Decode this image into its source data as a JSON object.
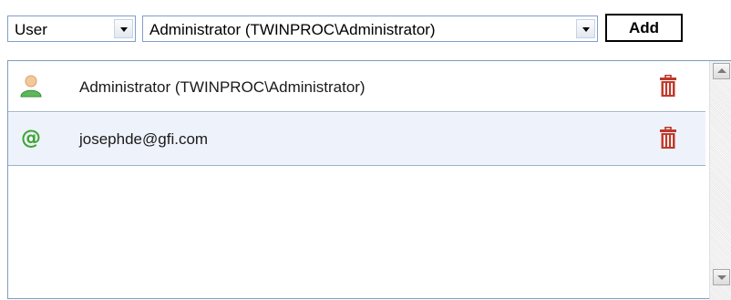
{
  "toolbar": {
    "type_select": {
      "value": "User",
      "icon": "chevron-down-icon"
    },
    "account_select": {
      "value": "Administrator (TWINPROC\\Administrator)",
      "icon": "chevron-down-icon"
    },
    "add_label": "Add"
  },
  "list": {
    "items": [
      {
        "label": "Administrator (TWINPROC\\Administrator)",
        "icon": "user-icon",
        "selected": false
      },
      {
        "label": "josephde@gfi.com",
        "icon": "email-at-icon",
        "selected": true
      }
    ],
    "delete_icon": "trash-icon"
  },
  "colors": {
    "selected_row_bg": "#eef2fa",
    "trash_red": "#c0392b",
    "user_icon_green": "#5cb85c",
    "at_icon_green": "#3fa535"
  }
}
